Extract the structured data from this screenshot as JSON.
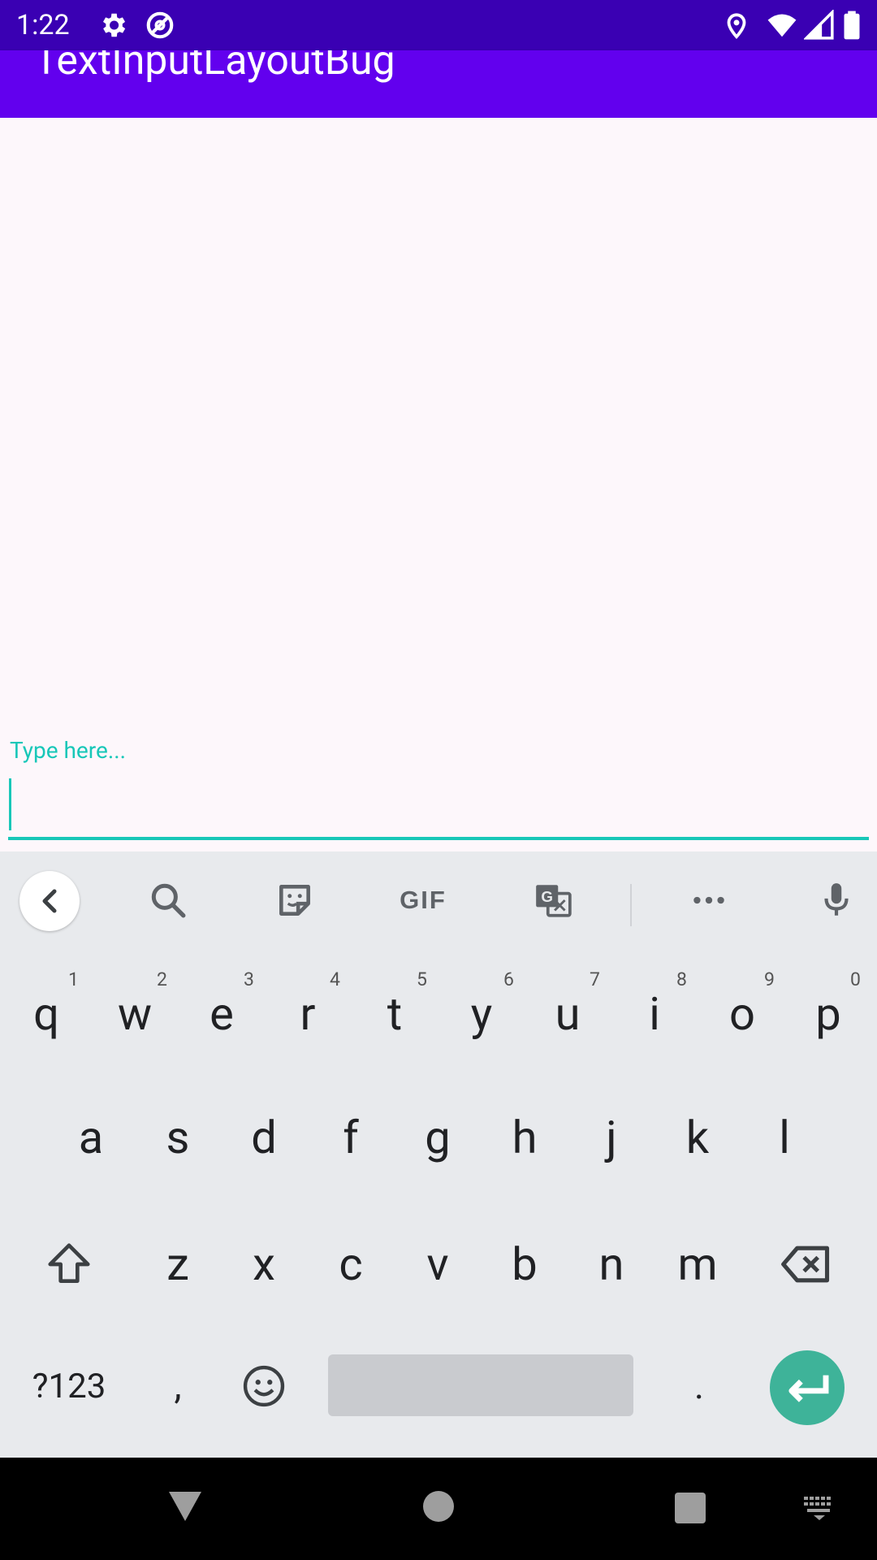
{
  "status_bar": {
    "time": "1:22",
    "icons": [
      "settings-icon",
      "sync-icon",
      "location-icon",
      "wifi-icon",
      "signal-icon",
      "battery-icon"
    ]
  },
  "app_bar": {
    "title": "TextInputLayoutBug"
  },
  "text_field": {
    "hint": "Type here...",
    "value": ""
  },
  "keyboard": {
    "toolbar": [
      "back-icon",
      "search-icon",
      "sticker-icon",
      "gif-button",
      "translate-icon",
      "more-icon",
      "mic-icon"
    ],
    "gif_label": "GIF",
    "row1": [
      {
        "key": "q",
        "hint": "1"
      },
      {
        "key": "w",
        "hint": "2"
      },
      {
        "key": "e",
        "hint": "3"
      },
      {
        "key": "r",
        "hint": "4"
      },
      {
        "key": "t",
        "hint": "5"
      },
      {
        "key": "y",
        "hint": "6"
      },
      {
        "key": "u",
        "hint": "7"
      },
      {
        "key": "i",
        "hint": "8"
      },
      {
        "key": "o",
        "hint": "9"
      },
      {
        "key": "p",
        "hint": "0"
      }
    ],
    "row2": [
      "a",
      "s",
      "d",
      "f",
      "g",
      "h",
      "j",
      "k",
      "l"
    ],
    "row3": [
      "z",
      "x",
      "c",
      "v",
      "b",
      "n",
      "m"
    ],
    "symbols_label": "?123",
    "comma_label": ",",
    "period_label": "."
  },
  "colors": {
    "accent": "#18c7b8",
    "app_bar": "#6200ee",
    "status_bar": "#3a00b3",
    "enter": "#3eb399"
  }
}
